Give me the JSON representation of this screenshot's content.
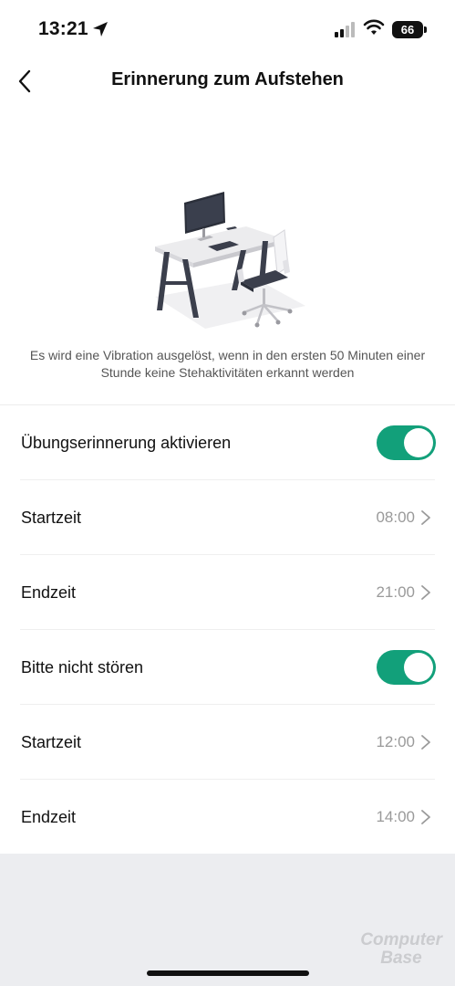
{
  "status_bar": {
    "time": "13:21",
    "battery": "66",
    "icons": [
      "location-arrow-icon",
      "cellular-signal-icon",
      "wifi-icon",
      "battery-icon"
    ]
  },
  "nav": {
    "title": "Erinnerung zum Aufstehen",
    "back_icon": "chevron-left-icon"
  },
  "description": "Es wird eine Vibration ausgelöst, wenn in den ersten 50 Minuten einer Stunde keine Stehaktivitäten erkannt werden",
  "rows": [
    {
      "label": "Übungserinnerung aktivieren",
      "type": "toggle",
      "on": true
    },
    {
      "label": "Startzeit",
      "type": "value",
      "value": "08:00"
    },
    {
      "label": "Endzeit",
      "type": "value",
      "value": "21:00"
    },
    {
      "label": "Bitte nicht stören",
      "type": "toggle",
      "on": true
    },
    {
      "label": "Startzeit",
      "type": "value",
      "value": "12:00"
    },
    {
      "label": "Endzeit",
      "type": "value",
      "value": "14:00"
    }
  ],
  "colors": {
    "accent": "#12a07a",
    "background": "#ffffff",
    "footer": "#ecedf0"
  },
  "watermark": {
    "line1": "Computer",
    "line2": "Base"
  }
}
